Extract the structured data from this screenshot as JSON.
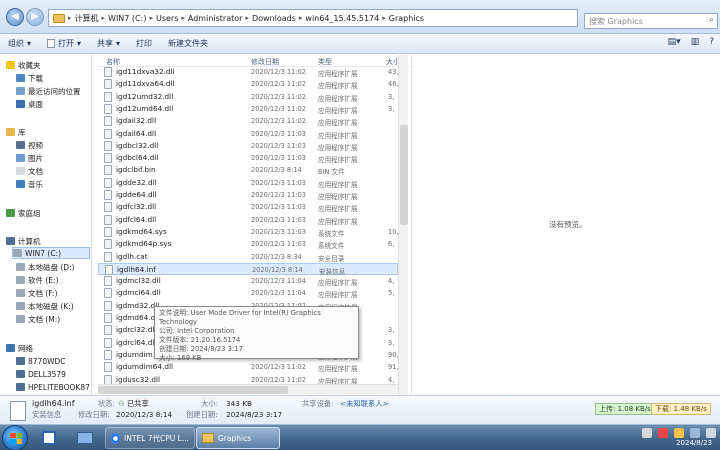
{
  "address": {
    "crumbs": [
      "计算机",
      "WIN7 (C:)",
      "Users",
      "Administrator",
      "Downloads",
      "win64_15.45.5174",
      "Graphics"
    ],
    "search_placeholder": "搜索 Graphics"
  },
  "toolbar": {
    "organize": "组织",
    "open": "打开",
    "share": "共享",
    "print": "打印",
    "new_folder": "新建文件夹"
  },
  "nav": {
    "favorites": "收藏夹",
    "downloads": "下载",
    "recent": "最近访问的位置",
    "desktop": "桌面",
    "libraries": "库",
    "videos": "视频",
    "pictures": "图片",
    "documents": "文档",
    "music": "音乐",
    "homegroup": "家庭组",
    "computer": "计算机",
    "drive_c": "WIN7 (C:)",
    "drive_d": "本地磁盘 (D:)",
    "drive_e": "软件 (E:)",
    "drive_f": "文档 (F:)",
    "drive_k": "本地磁盘 (K:)",
    "drive_m": "文档 (M:)",
    "network": "网络",
    "net1": "8770WDC",
    "net2": "DELL3579",
    "net3": "HPELITEBOOK87"
  },
  "columns": {
    "name": "名称",
    "date": "修改日期",
    "type": "类型",
    "size": "大小"
  },
  "files": [
    {
      "name": "igd11dxva32.dll",
      "date": "2020/12/3 11:02",
      "type": "应用程序扩展",
      "size": "43,"
    },
    {
      "name": "igd11dxva64.dll",
      "date": "2020/12/3 11:02",
      "type": "应用程序扩展",
      "size": "46,"
    },
    {
      "name": "igd12umd32.dll",
      "date": "2020/12/3 11:02",
      "type": "应用程序扩展",
      "size": "3,"
    },
    {
      "name": "igd12umd64.dll",
      "date": "2020/12/3 11:02",
      "type": "应用程序扩展",
      "size": "3,"
    },
    {
      "name": "igdail32.dll",
      "date": "2020/12/3 11:02",
      "type": "应用程序扩展",
      "size": ""
    },
    {
      "name": "igdail64.dll",
      "date": "2020/12/3 11:03",
      "type": "应用程序扩展",
      "size": ""
    },
    {
      "name": "igdbcl32.dll",
      "date": "2020/12/3 11:03",
      "type": "应用程序扩展",
      "size": ""
    },
    {
      "name": "igdbcl64.dll",
      "date": "2020/12/3 11:03",
      "type": "应用程序扩展",
      "size": ""
    },
    {
      "name": "igdclbif.bin",
      "date": "2020/12/3 8:14",
      "type": "BIN 文件",
      "size": ""
    },
    {
      "name": "igdde32.dll",
      "date": "2020/12/3 11:03",
      "type": "应用程序扩展",
      "size": ""
    },
    {
      "name": "igdde64.dll",
      "date": "2020/12/3 11:03",
      "type": "应用程序扩展",
      "size": ""
    },
    {
      "name": "igdfcl32.dll",
      "date": "2020/12/3 11:03",
      "type": "应用程序扩展",
      "size": ""
    },
    {
      "name": "igdfcl64.dll",
      "date": "2020/12/3 11:03",
      "type": "应用程序扩展",
      "size": ""
    },
    {
      "name": "igdkmd64.sys",
      "date": "2020/12/3 11:03",
      "type": "系统文件",
      "size": "10,"
    },
    {
      "name": "igdkmd64p.sys",
      "date": "2020/12/3 11:03",
      "type": "系统文件",
      "size": "6,"
    },
    {
      "name": "igdlh.cat",
      "date": "2020/12/3 8:34",
      "type": "安全目录",
      "size": ""
    },
    {
      "name": "igdlh64.inf",
      "date": "2020/12/3 8:14",
      "type": "安装信息",
      "size": ""
    },
    {
      "name": "igdmcl32.dll",
      "date": "2020/12/3 11:04",
      "type": "应用程序扩展",
      "size": "4,"
    },
    {
      "name": "igdmcl64.dll",
      "date": "2020/12/3 11:04",
      "type": "应用程序扩展",
      "size": "5,"
    },
    {
      "name": "igdmd32.dll",
      "date": "2020/12/3 11:02",
      "type": "应用程序扩展",
      "size": ""
    },
    {
      "name": "igdmd64.dll",
      "date": "2020/12/3 11:02",
      "type": "应用程序扩展",
      "size": ""
    },
    {
      "name": "igdrcl32.dll",
      "date": "2020/12/3 11:02",
      "type": "应用程序扩展",
      "size": "3,"
    },
    {
      "name": "igdrcl64.dll",
      "date": "2020/12/3 11:02",
      "type": "应用程序扩展",
      "size": "3,"
    },
    {
      "name": "igdumdim3",
      "date": "2020/12/3 11:02",
      "type": "应用程序扩展",
      "size": "90,"
    },
    {
      "name": "igdumdim64.dll",
      "date": "2020/12/3 11:02",
      "type": "应用程序扩展",
      "size": "91,"
    },
    {
      "name": "igdusc32.dll",
      "date": "2020/12/3 11:02",
      "type": "应用程序扩展",
      "size": "4,"
    }
  ],
  "preview": {
    "message": "没有预览。"
  },
  "tooltip": {
    "line1": "文件说明: User Mode Driver for Intel(R) Graphics Technology",
    "line2": "公司: Intel Corporation",
    "line3": "文件版本: 21.20.16.5174",
    "line4": "创建日期: 2024/8/23 3:17",
    "line5": "大小: 169 KB"
  },
  "details": {
    "filename": "igdlh64.inf",
    "filetype": "安装信息",
    "status_label": "状态:",
    "status_value": "已共享",
    "modified_label": "修改日期:",
    "modified_value": "2020/12/3 8:14",
    "size_label": "大小:",
    "size_value": "343 KB",
    "created_label": "创建日期:",
    "created_value": "2024/8/23 3:17",
    "shared_label": "共享设备:",
    "shared_value": "<未知联系人>"
  },
  "netmon": {
    "up": "上传: 1.08 KB/s",
    "down": "下载: 1.48 KB/s"
  },
  "taskbar": {
    "task1": "INTEL 7代CPU L...",
    "task2": "Graphics",
    "date": "2024/8/23"
  },
  "colors": {
    "selection": "#dbeafc",
    "taskbar": "#3f6387"
  }
}
